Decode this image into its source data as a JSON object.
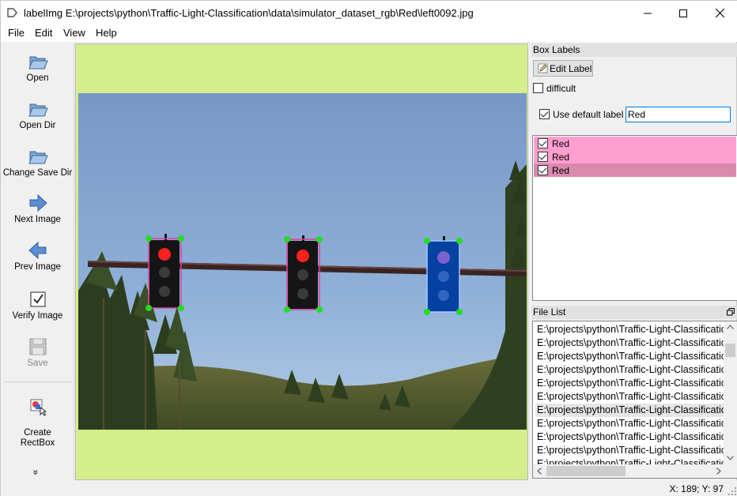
{
  "window": {
    "title": "labelImg E:\\projects\\python\\Traffic-Light-Classification\\data\\simulator_dataset_rgb\\Red\\left0092.jpg"
  },
  "menu": [
    "File",
    "Edit",
    "View",
    "Help"
  ],
  "toolbar": {
    "items": [
      {
        "label": "Open",
        "icon": "open-folder-icon"
      },
      {
        "label": "Open Dir",
        "icon": "open-dir-icon"
      },
      {
        "label": "Change Save Dir",
        "icon": "change-save-dir-icon"
      },
      {
        "label": "Next Image",
        "icon": "arrow-right-icon"
      },
      {
        "label": "Prev Image",
        "icon": "arrow-left-icon"
      },
      {
        "label": "Verify Image",
        "icon": "verify-check-icon"
      },
      {
        "label": "Save",
        "icon": "save-disk-icon",
        "disabled": true
      },
      {
        "label": "Create\nRectBox",
        "icon": "create-rectbox-icon"
      }
    ],
    "more": "»"
  },
  "box_labels": {
    "title": "Box Labels",
    "edit_label_button": "Edit Label",
    "difficult_label": "difficult",
    "difficult_checked": false,
    "use_default_label": "Use default label",
    "use_default_checked": true,
    "default_label_value": "Red",
    "labels": [
      {
        "text": "Red",
        "checked": true,
        "color": "#ff9fcf"
      },
      {
        "text": "Red",
        "checked": true,
        "color": "#ff9fcf"
      },
      {
        "text": "Red",
        "checked": true,
        "color": "#d98aad"
      }
    ]
  },
  "file_list": {
    "title": "File List",
    "items": [
      "E:\\projects\\python\\Traffic-Light-Classification",
      "E:\\projects\\python\\Traffic-Light-Classification",
      "E:\\projects\\python\\Traffic-Light-Classification",
      "E:\\projects\\python\\Traffic-Light-Classification",
      "E:\\projects\\python\\Traffic-Light-Classification",
      "E:\\projects\\python\\Traffic-Light-Classification",
      "E:\\projects\\python\\Traffic-Light-Classification",
      "E:\\projects\\python\\Traffic-Light-Classification",
      "E:\\projects\\python\\Traffic-Light-Classification",
      "E:\\projects\\python\\Traffic-Light-Classification",
      "E:\\projects\\python\\Traffic-Light-Classification"
    ],
    "selected_index": 6
  },
  "status": {
    "coords": "X: 189; Y: 97"
  },
  "colors": {
    "canvas_bg": "#d4ee8c",
    "box_outline": "#e040a0",
    "box_vertex": "#22dd22",
    "selected_box_fill": "#0050d0"
  }
}
